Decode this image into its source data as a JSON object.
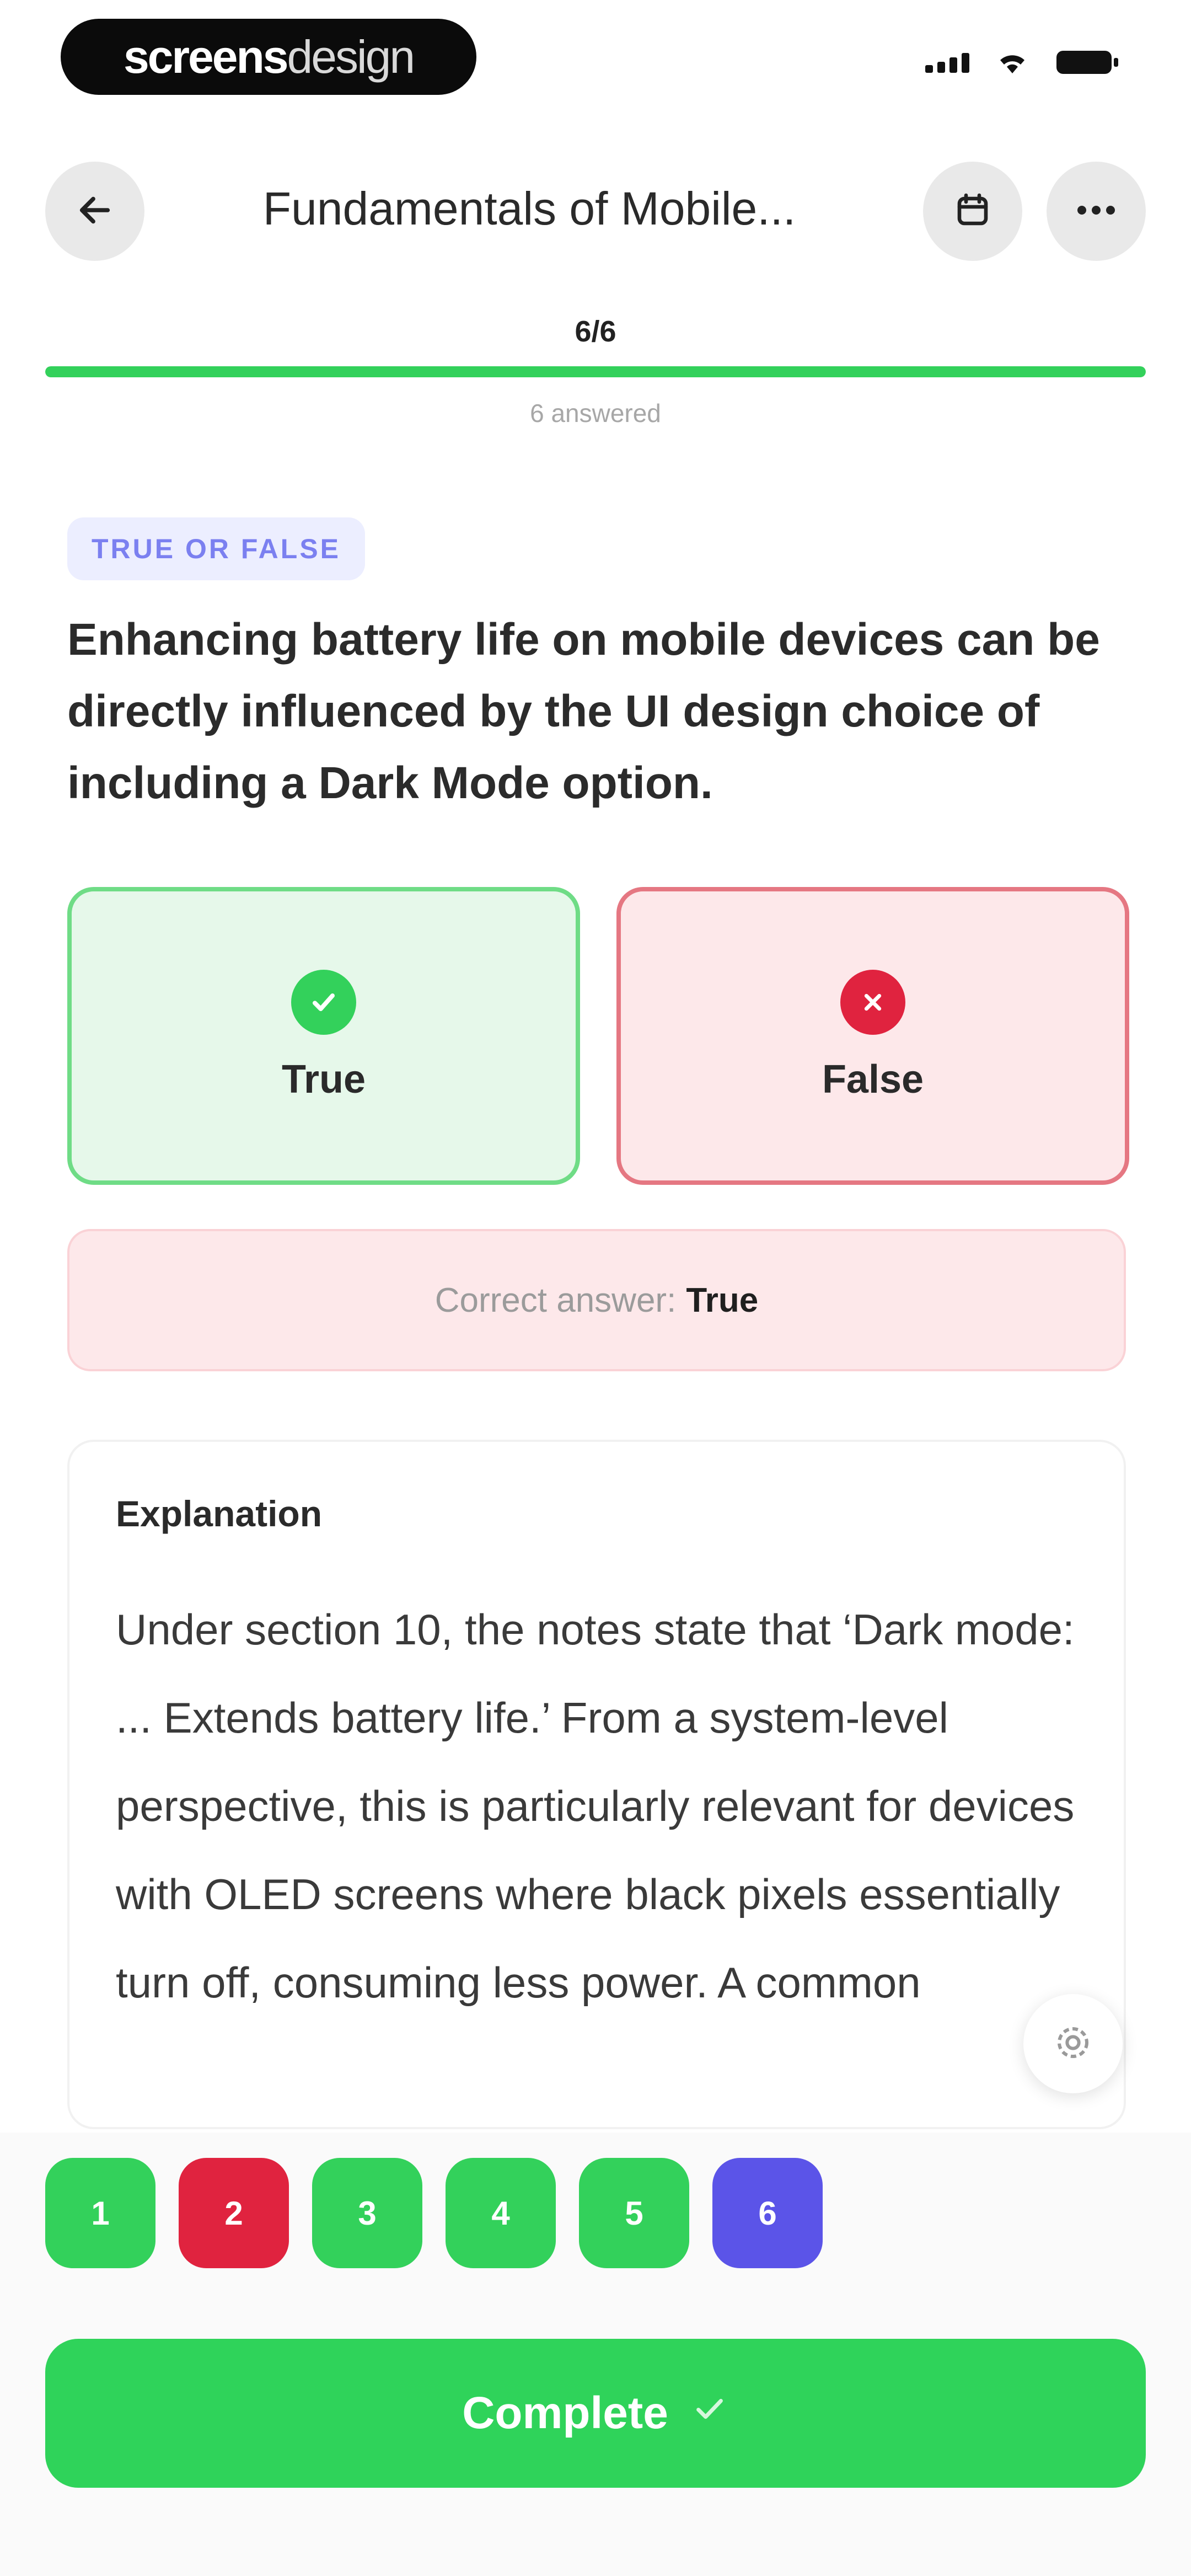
{
  "status_bar": {
    "brand_bold": "screens",
    "brand_light": "design"
  },
  "header": {
    "title": "Fundamentals of Mobile..."
  },
  "progress": {
    "count": "6/6",
    "answered": "6 answered",
    "fraction": 1.0
  },
  "question": {
    "type_label": "TRUE OR FALSE",
    "text": "Enhancing battery life on mobile devices can be directly influenced by the UI design choice of including a Dark Mode option."
  },
  "options": [
    {
      "label": "True",
      "state": "correct",
      "icon": "check-icon"
    },
    {
      "label": "False",
      "state": "incorrect",
      "icon": "x-icon"
    }
  ],
  "feedback": {
    "correct_label": "Correct answer:",
    "correct_value": "True"
  },
  "explanation": {
    "title": "Explanation",
    "body": "Under section 10, the notes state that ‘Dark mode: ... Extends battery life.’ From a system-level perspective, this is particularly relevant for devices with OLED screens where black pixels essentially turn off, consuming less power. A common"
  },
  "question_nav": [
    {
      "number": "1",
      "status": "correct",
      "color": "#33d15b"
    },
    {
      "number": "2",
      "status": "incorrect",
      "color": "#e0233f"
    },
    {
      "number": "3",
      "status": "correct",
      "color": "#33d15b"
    },
    {
      "number": "4",
      "status": "correct",
      "color": "#33d15b"
    },
    {
      "number": "5",
      "status": "correct",
      "color": "#33d15b"
    },
    {
      "number": "6",
      "status": "current",
      "color": "#5b54e8"
    }
  ],
  "actions": {
    "complete_label": "Complete"
  },
  "colors": {
    "accent_green": "#33d15b",
    "error_red": "#e0233f",
    "current_purple": "#5b54e8"
  }
}
